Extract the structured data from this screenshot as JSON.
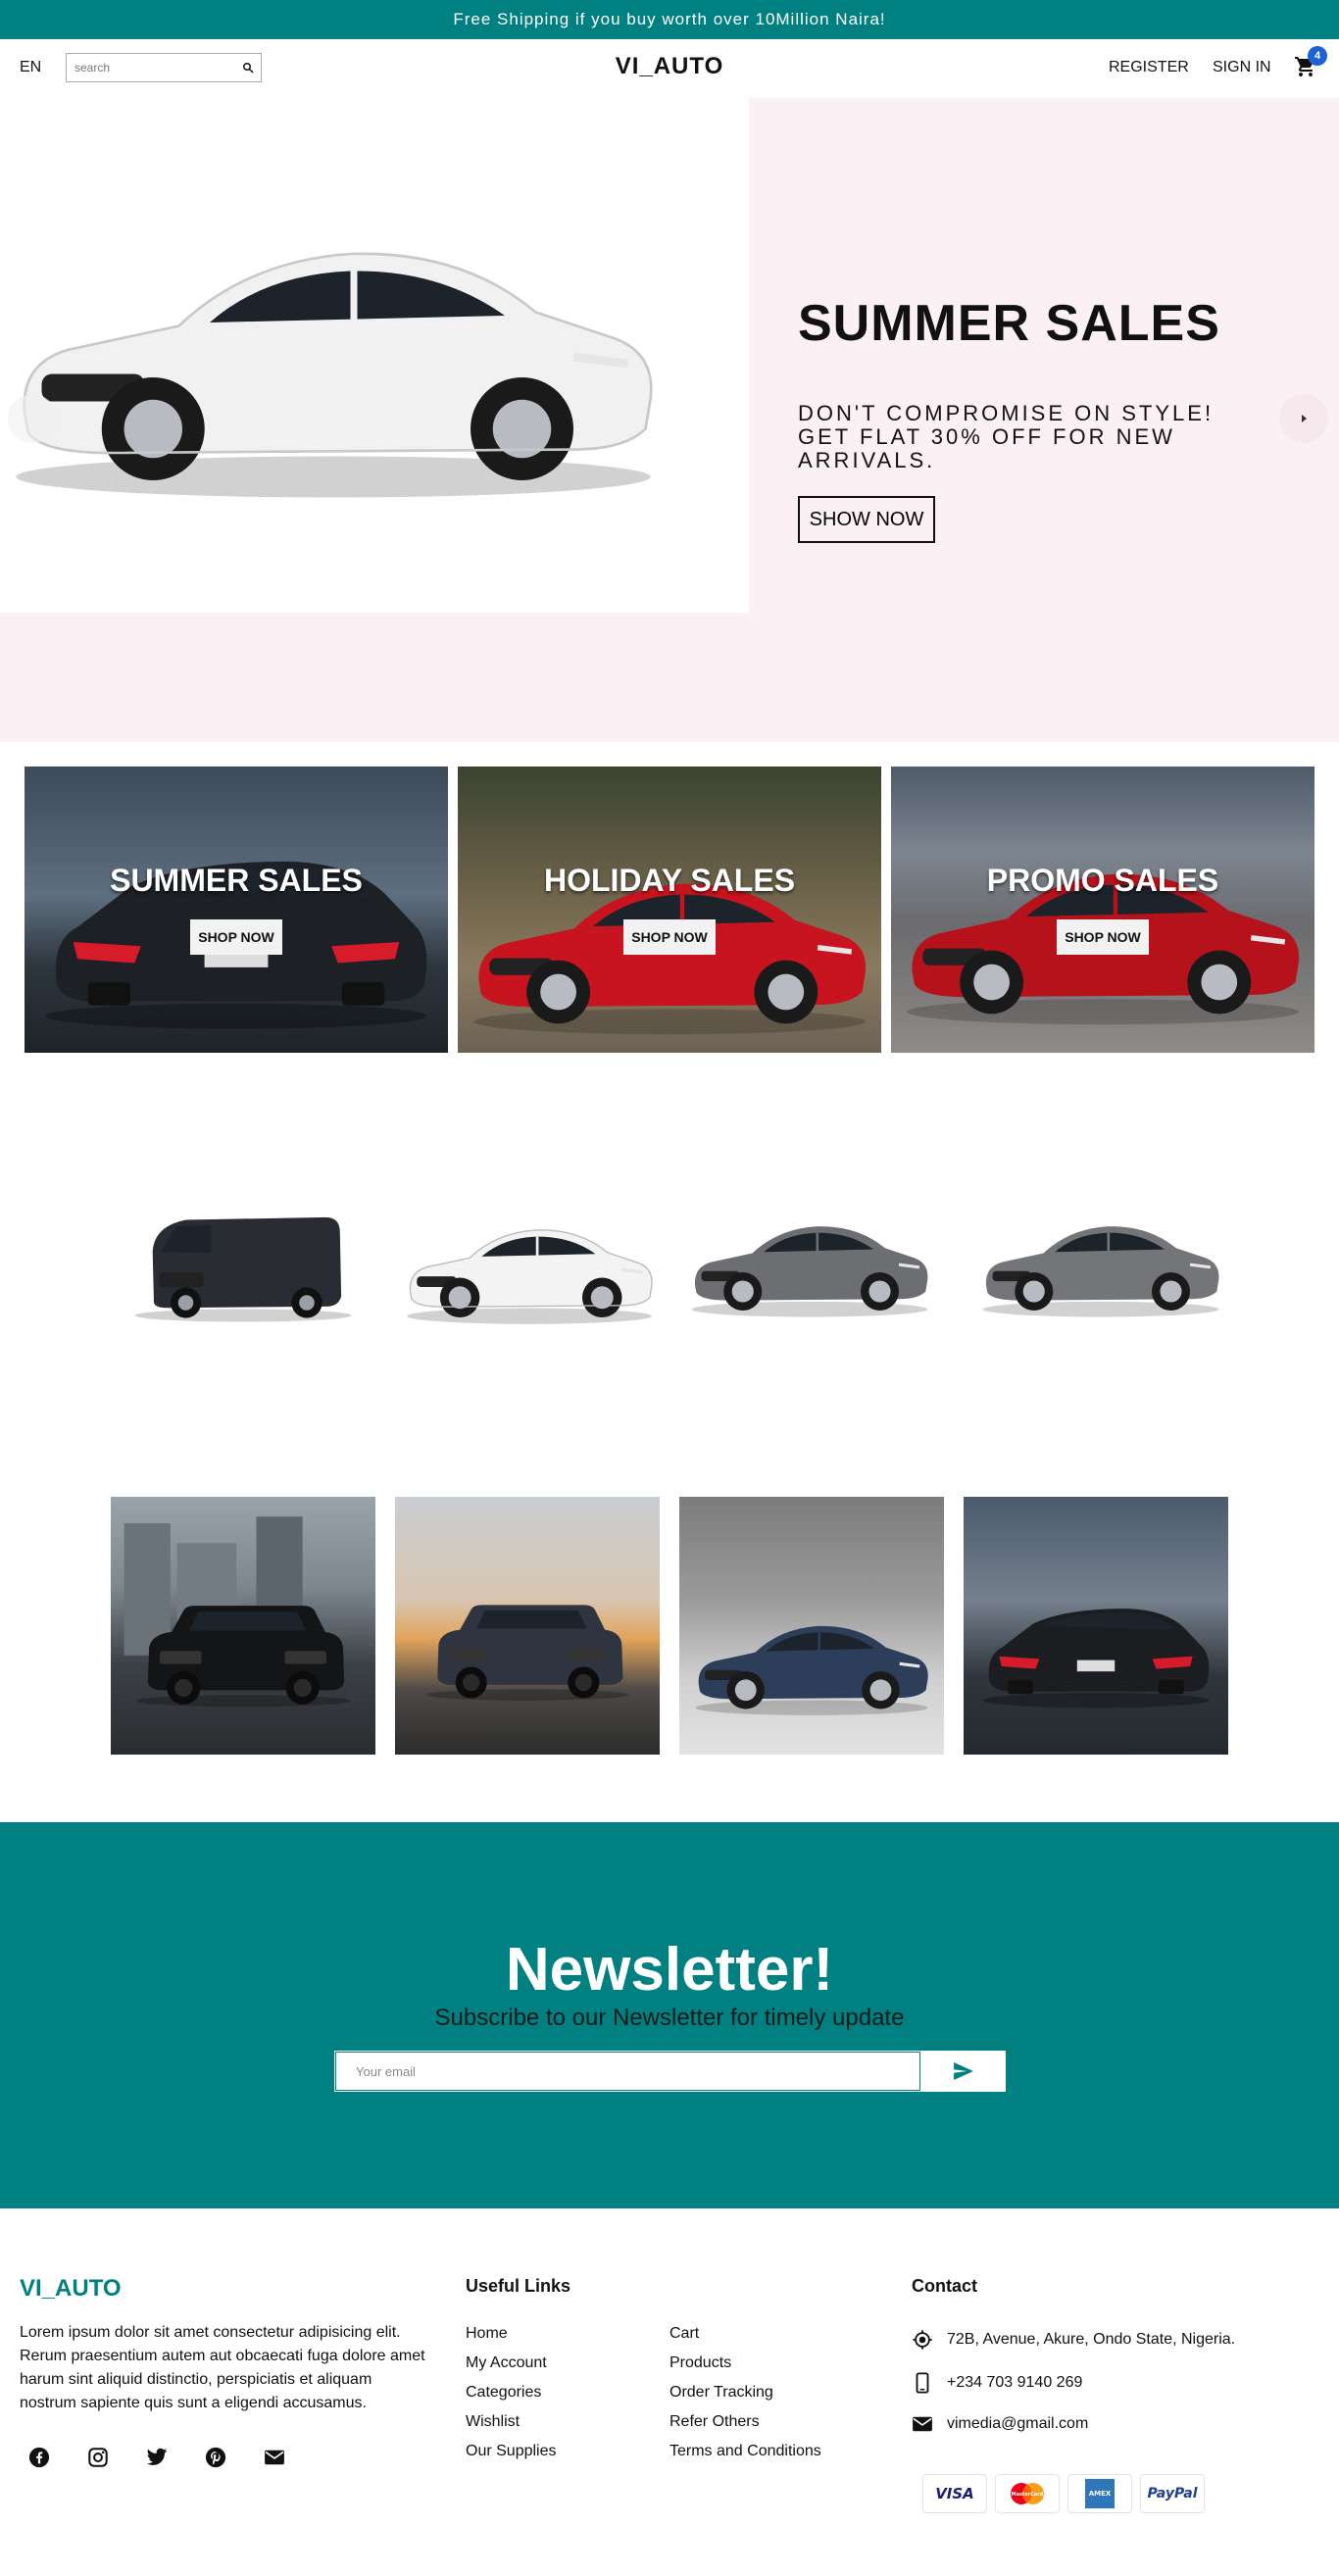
{
  "announcement": "Free Shipping if you buy worth over 10Million Naira!",
  "header": {
    "lang": "EN",
    "search_placeholder": "search",
    "logo": "VI_AUTO",
    "register": "REGISTER",
    "signin": "SIGN IN",
    "cart_count": "4"
  },
  "hero": {
    "title": "SUMMER SALES",
    "description": "DON'T COMPROMISE ON STYLE! GET FLAT 30% OFF FOR NEW ARRIVALS.",
    "button": "SHOW NOW"
  },
  "categories": [
    {
      "title": "SUMMER SALES",
      "button": "SHOP NOW"
    },
    {
      "title": "HOLIDAY SALES",
      "button": "SHOP NOW"
    },
    {
      "title": "PROMO SALES",
      "button": "SHOP NOW"
    }
  ],
  "newsletter": {
    "title": "Newsletter!",
    "subtitle": "Subscribe to our Newsletter for timely update",
    "placeholder": "Your email"
  },
  "footer": {
    "logo": "VI_AUTO",
    "description": "Lorem ipsum dolor sit amet consectetur adipisicing elit. Rerum praesentium autem aut obcaecati fuga dolore amet harum sint aliquid distinctio, perspiciatis et aliquam nostrum sapiente quis sunt a eligendi accusamus.",
    "useful_links_title": "Useful Links",
    "links_col1": [
      "Home",
      "My Account",
      "Categories",
      "Wishlist",
      "Our Supplies"
    ],
    "links_col2": [
      "Cart",
      "Products",
      "Order Tracking",
      "Refer Others",
      "Terms and Conditions"
    ],
    "contact_title": "Contact",
    "address": "72B, Avenue, Akure, Ondo State, Nigeria.",
    "phone": "+234 703 9140 269",
    "email": "vimedia@gmail.com",
    "payments": [
      "VISA",
      "MasterCard",
      "AMEX",
      "PayPal"
    ]
  },
  "colors": {
    "brand_teal": "#008080",
    "hero_bg": "#fbf0f4",
    "badge_blue": "#1e63d6"
  },
  "icons": [
    "search-icon",
    "cart-icon",
    "arrow-right-icon",
    "send-icon",
    "facebook-icon",
    "instagram-icon",
    "twitter-icon",
    "pinterest-icon",
    "mail-icon",
    "location-icon",
    "phone-icon",
    "email-icon"
  ]
}
